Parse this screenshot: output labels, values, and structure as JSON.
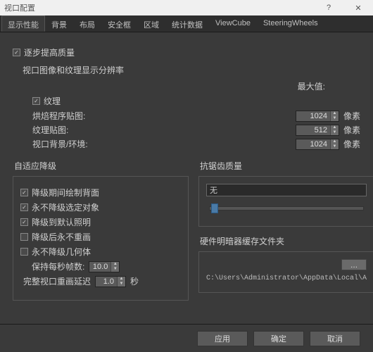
{
  "window": {
    "title": "视口配置"
  },
  "tabs": [
    "显示性能",
    "背景",
    "布局",
    "安全框",
    "区域",
    "统计数据",
    "ViewCube",
    "SteeringWheels"
  ],
  "active_tab": 0,
  "progressive": {
    "label": "逐步提高质量"
  },
  "resolution": {
    "heading": "视口图像和纹理显示分辨率",
    "texture_label": "纹理",
    "max_label": "最大值:",
    "rows": [
      {
        "label": "烘焙程序贴图:",
        "value": "1024",
        "unit": "像素"
      },
      {
        "label": "纹理贴图:",
        "value": "512",
        "unit": "像素"
      },
      {
        "label": "视口背景/环境:",
        "value": "1024",
        "unit": "像素"
      }
    ]
  },
  "adaptive": {
    "title": "自适应降级",
    "items": [
      {
        "label": "降级期间绘制背面",
        "checked": true
      },
      {
        "label": "永不降级选定对象",
        "checked": true
      },
      {
        "label": "降级到默认照明",
        "checked": true
      },
      {
        "label": "降级后永不重画",
        "checked": false
      },
      {
        "label": "永不降级几何体",
        "checked": false
      }
    ],
    "fps_label": "保持每秒帧数:",
    "fps_value": "10.0",
    "redraw_label": "完整视口重画延迟",
    "redraw_value": "1.0",
    "redraw_unit": "秒"
  },
  "antialias": {
    "title": "抗锯齿质量",
    "value": "无"
  },
  "cache": {
    "title": "硬件明暗器缓存文件夹",
    "browse": "...",
    "path": "C:\\Users\\Administrator\\AppData\\Local\\A"
  },
  "footer": {
    "apply": "应用",
    "ok": "确定",
    "cancel": "取消"
  }
}
